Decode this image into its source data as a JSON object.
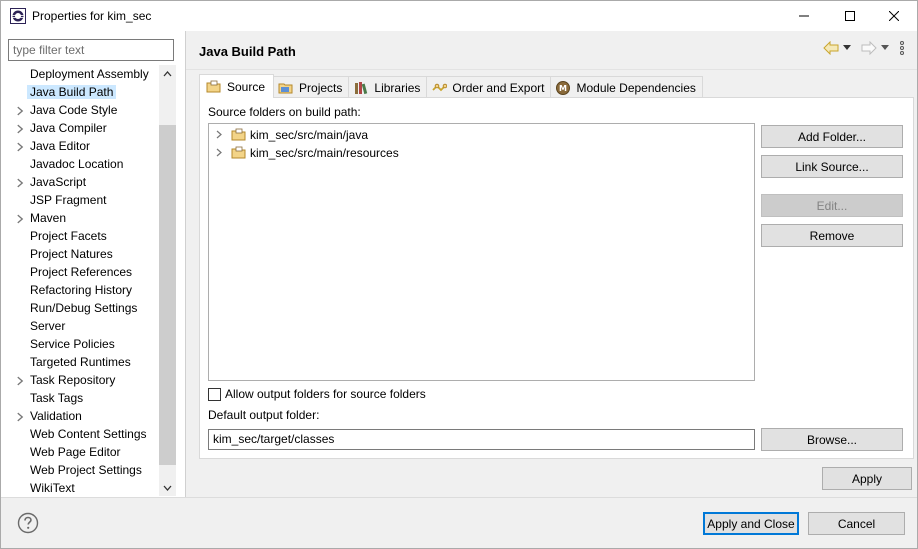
{
  "window": {
    "title": "Properties for kim_sec"
  },
  "filter": {
    "placeholder": "type filter text"
  },
  "sidebar": {
    "items": [
      {
        "label": "Deployment Assembly",
        "expandable": false
      },
      {
        "label": "Java Build Path",
        "expandable": false,
        "selected": true
      },
      {
        "label": "Java Code Style",
        "expandable": true
      },
      {
        "label": "Java Compiler",
        "expandable": true
      },
      {
        "label": "Java Editor",
        "expandable": true
      },
      {
        "label": "Javadoc Location",
        "expandable": false
      },
      {
        "label": "JavaScript",
        "expandable": true
      },
      {
        "label": "JSP Fragment",
        "expandable": false
      },
      {
        "label": "Maven",
        "expandable": true
      },
      {
        "label": "Project Facets",
        "expandable": false
      },
      {
        "label": "Project Natures",
        "expandable": false
      },
      {
        "label": "Project References",
        "expandable": false
      },
      {
        "label": "Refactoring History",
        "expandable": false
      },
      {
        "label": "Run/Debug Settings",
        "expandable": false
      },
      {
        "label": "Server",
        "expandable": false
      },
      {
        "label": "Service Policies",
        "expandable": false
      },
      {
        "label": "Targeted Runtimes",
        "expandable": false
      },
      {
        "label": "Task Repository",
        "expandable": true
      },
      {
        "label": "Task Tags",
        "expandable": false
      },
      {
        "label": "Validation",
        "expandable": true
      },
      {
        "label": "Web Content Settings",
        "expandable": false
      },
      {
        "label": "Web Page Editor",
        "expandable": false
      },
      {
        "label": "Web Project Settings",
        "expandable": false
      },
      {
        "label": "WikiText",
        "expandable": false
      }
    ]
  },
  "page": {
    "title": "Java Build Path",
    "tabs": [
      {
        "label": "Source",
        "icon": "source-folder-icon",
        "active": true
      },
      {
        "label": "Projects",
        "icon": "projects-icon"
      },
      {
        "label": "Libraries",
        "icon": "libraries-icon"
      },
      {
        "label": "Order and Export",
        "icon": "order-export-icon"
      },
      {
        "label": "Module Dependencies",
        "icon": "module-icon"
      }
    ],
    "source": {
      "section_label": "Source folders on build path:",
      "folders": [
        "kim_sec/src/main/java",
        "kim_sec/src/main/resources"
      ],
      "buttons": {
        "add_folder": "Add Folder...",
        "link_source": "Link Source...",
        "edit": "Edit...",
        "remove": "Remove",
        "browse": "Browse..."
      },
      "allow_output_label": "Allow output folders for source folders",
      "allow_output_checked": false,
      "default_output_label": "Default output folder:",
      "default_output_value": "kim_sec/target/classes"
    },
    "apply_label": "Apply"
  },
  "footer": {
    "apply_close_label": "Apply and Close",
    "cancel_label": "Cancel"
  },
  "colors": {
    "selection": "#cce8ff",
    "accent": "#0078d7"
  }
}
